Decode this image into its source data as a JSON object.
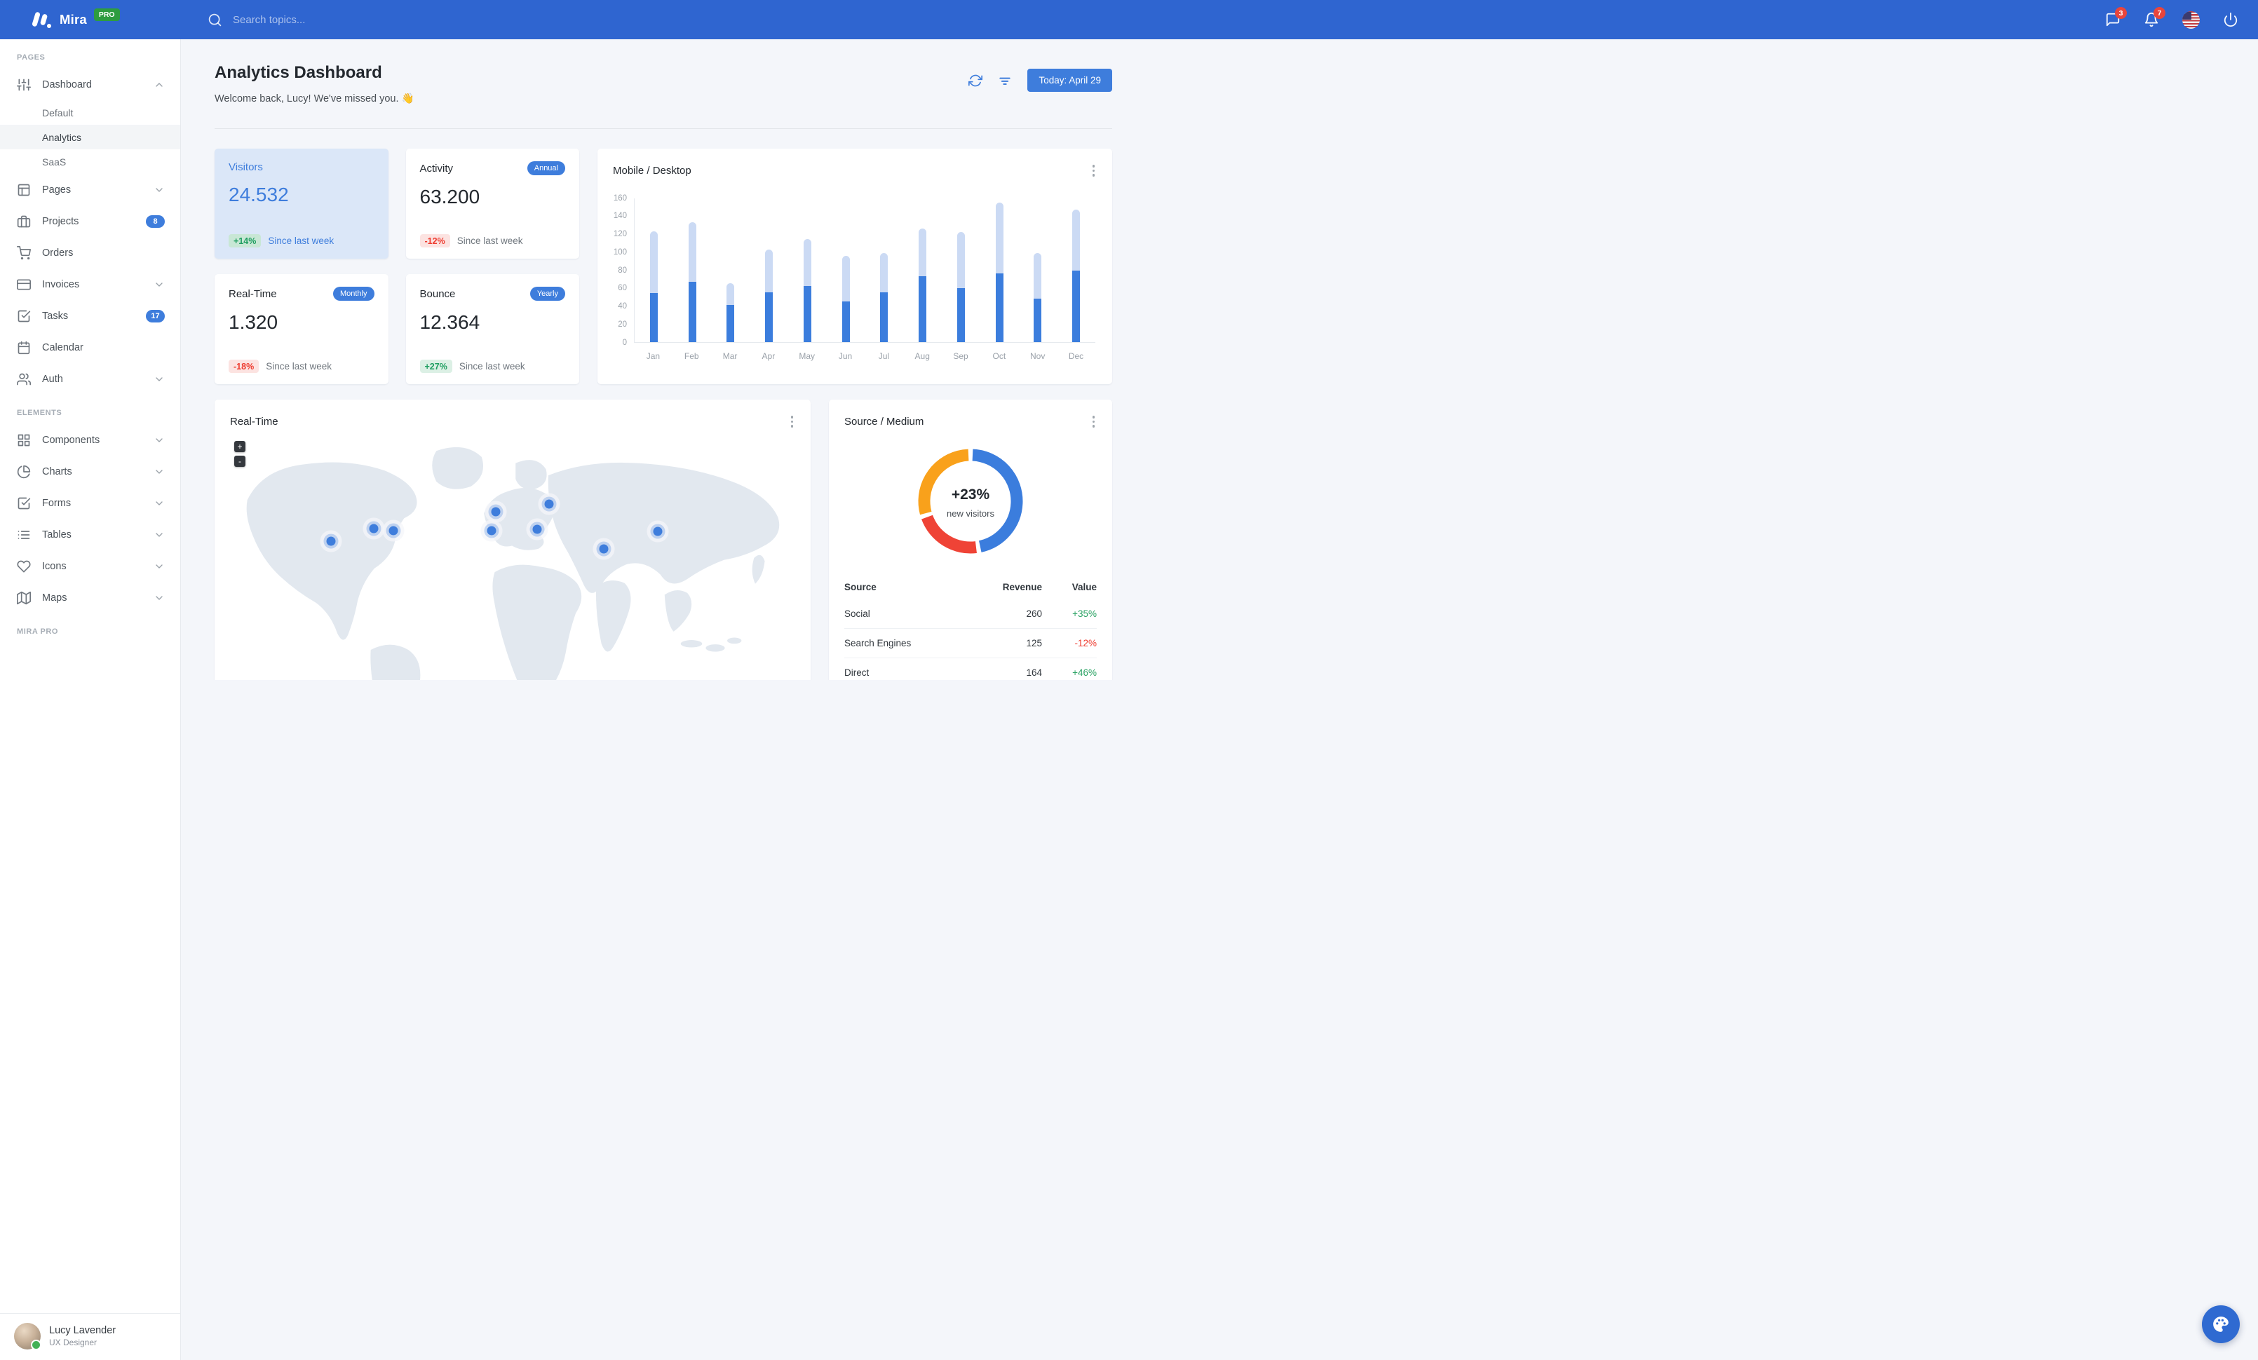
{
  "navbar": {
    "brand": "Mira",
    "brand_badge": "PRO",
    "search_placeholder": "Search topics...",
    "messages_badge": "3",
    "notifications_badge": "7"
  },
  "sidebar": {
    "sections": [
      {
        "label": "PAGES",
        "items": [
          {
            "label": "Dashboard",
            "icon": "sliders",
            "chevron": "up",
            "children": [
              {
                "label": "Default",
                "active": false
              },
              {
                "label": "Analytics",
                "active": true
              },
              {
                "label": "SaaS",
                "active": false
              }
            ]
          },
          {
            "label": "Pages",
            "icon": "layout",
            "chevron": "down"
          },
          {
            "label": "Projects",
            "icon": "briefcase",
            "badge": "8"
          },
          {
            "label": "Orders",
            "icon": "cart"
          },
          {
            "label": "Invoices",
            "icon": "credit-card",
            "chevron": "down"
          },
          {
            "label": "Tasks",
            "icon": "check-square",
            "badge": "17"
          },
          {
            "label": "Calendar",
            "icon": "calendar"
          },
          {
            "label": "Auth",
            "icon": "users",
            "chevron": "down"
          }
        ]
      },
      {
        "label": "ELEMENTS",
        "items": [
          {
            "label": "Components",
            "icon": "grid",
            "chevron": "down"
          },
          {
            "label": "Charts",
            "icon": "pie-chart",
            "chevron": "down"
          },
          {
            "label": "Forms",
            "icon": "check-square",
            "chevron": "down"
          },
          {
            "label": "Tables",
            "icon": "list",
            "chevron": "down"
          },
          {
            "label": "Icons",
            "icon": "heart",
            "chevron": "down"
          },
          {
            "label": "Maps",
            "icon": "map",
            "chevron": "down"
          }
        ]
      },
      {
        "label": "MIRA PRO",
        "items": []
      }
    ],
    "user": {
      "name": "Lucy Lavender",
      "role": "UX Designer"
    }
  },
  "header": {
    "title": "Analytics Dashboard",
    "subtitle": "Welcome back, Lucy! We've missed you. 👋",
    "date_button": "Today: April 29"
  },
  "stats": [
    {
      "title": "Visitors",
      "value": "24.532",
      "delta": "+14%",
      "direction": "up",
      "caption": "Since last week",
      "highlight": true
    },
    {
      "title": "Activity",
      "value": "63.200",
      "badge": "Annual",
      "delta": "-12%",
      "direction": "down",
      "caption": "Since last week"
    },
    {
      "title": "Real-Time",
      "value": "1.320",
      "badge": "Monthly",
      "delta": "-18%",
      "direction": "down",
      "caption": "Since last week"
    },
    {
      "title": "Bounce",
      "value": "12.364",
      "badge": "Yearly",
      "delta": "+27%",
      "direction": "up",
      "caption": "Since last week"
    }
  ],
  "chart_data": [
    {
      "type": "bar",
      "stacked": true,
      "title": "Mobile / Desktop",
      "categories": [
        "Jan",
        "Feb",
        "Mar",
        "Apr",
        "May",
        "Jun",
        "Jul",
        "Aug",
        "Sep",
        "Oct",
        "Nov",
        "Dec"
      ],
      "series": [
        {
          "name": "Mobile",
          "color": "#3b7ddd",
          "values": [
            54,
            67,
            41,
            55,
            62,
            45,
            55,
            73,
            60,
            76,
            48,
            79
          ]
        },
        {
          "name": "Desktop",
          "color": "#cbdaf4",
          "values": [
            69,
            66,
            24,
            48,
            52,
            51,
            44,
            53,
            62,
            79,
            51,
            68
          ]
        }
      ],
      "xlabel": "",
      "ylabel": "",
      "ylim": [
        0,
        160
      ],
      "yticks": [
        0,
        20,
        40,
        60,
        80,
        100,
        120,
        140,
        160
      ],
      "grid": false,
      "legend": "none"
    },
    {
      "type": "donut",
      "title": "Source / Medium",
      "center_value": "+23%",
      "center_label": "new visitors",
      "labels": [
        "Social",
        "Search Engines",
        "Direct"
      ],
      "values": [
        260,
        125,
        164
      ],
      "colors": [
        "#3b7ddd",
        "#ef4336",
        "#f9a11b"
      ],
      "legend": "none"
    }
  ],
  "realtime_map": {
    "title": "Real-Time",
    "zoom_in_label": "+",
    "zoom_out_label": "-",
    "markers": [
      {
        "x": 19.5,
        "y": 30.2
      },
      {
        "x": 26.7,
        "y": 26.8
      },
      {
        "x": 30.0,
        "y": 27.4
      },
      {
        "x": 47.2,
        "y": 22.2
      },
      {
        "x": 46.5,
        "y": 27.4
      },
      {
        "x": 56.1,
        "y": 20.0
      },
      {
        "x": 54.1,
        "y": 27.0
      },
      {
        "x": 65.3,
        "y": 32.4
      },
      {
        "x": 74.4,
        "y": 27.6
      }
    ]
  },
  "source_table": {
    "headers": [
      "Source",
      "Revenue",
      "Value"
    ],
    "rows": [
      {
        "source": "Social",
        "revenue": "260",
        "value": "+35%"
      },
      {
        "source": "Search Engines",
        "revenue": "125",
        "value": "-12%"
      },
      {
        "source": "Direct",
        "revenue": "164",
        "value": "+46%"
      }
    ]
  },
  "colors": {
    "navbar": "#2f65d0",
    "primary": "#3e7ddc",
    "danger": "#e8453c",
    "success": "#1e9e60",
    "highlight_card_bg": "#dbe7f8",
    "map_land": "#e2e8ef"
  }
}
